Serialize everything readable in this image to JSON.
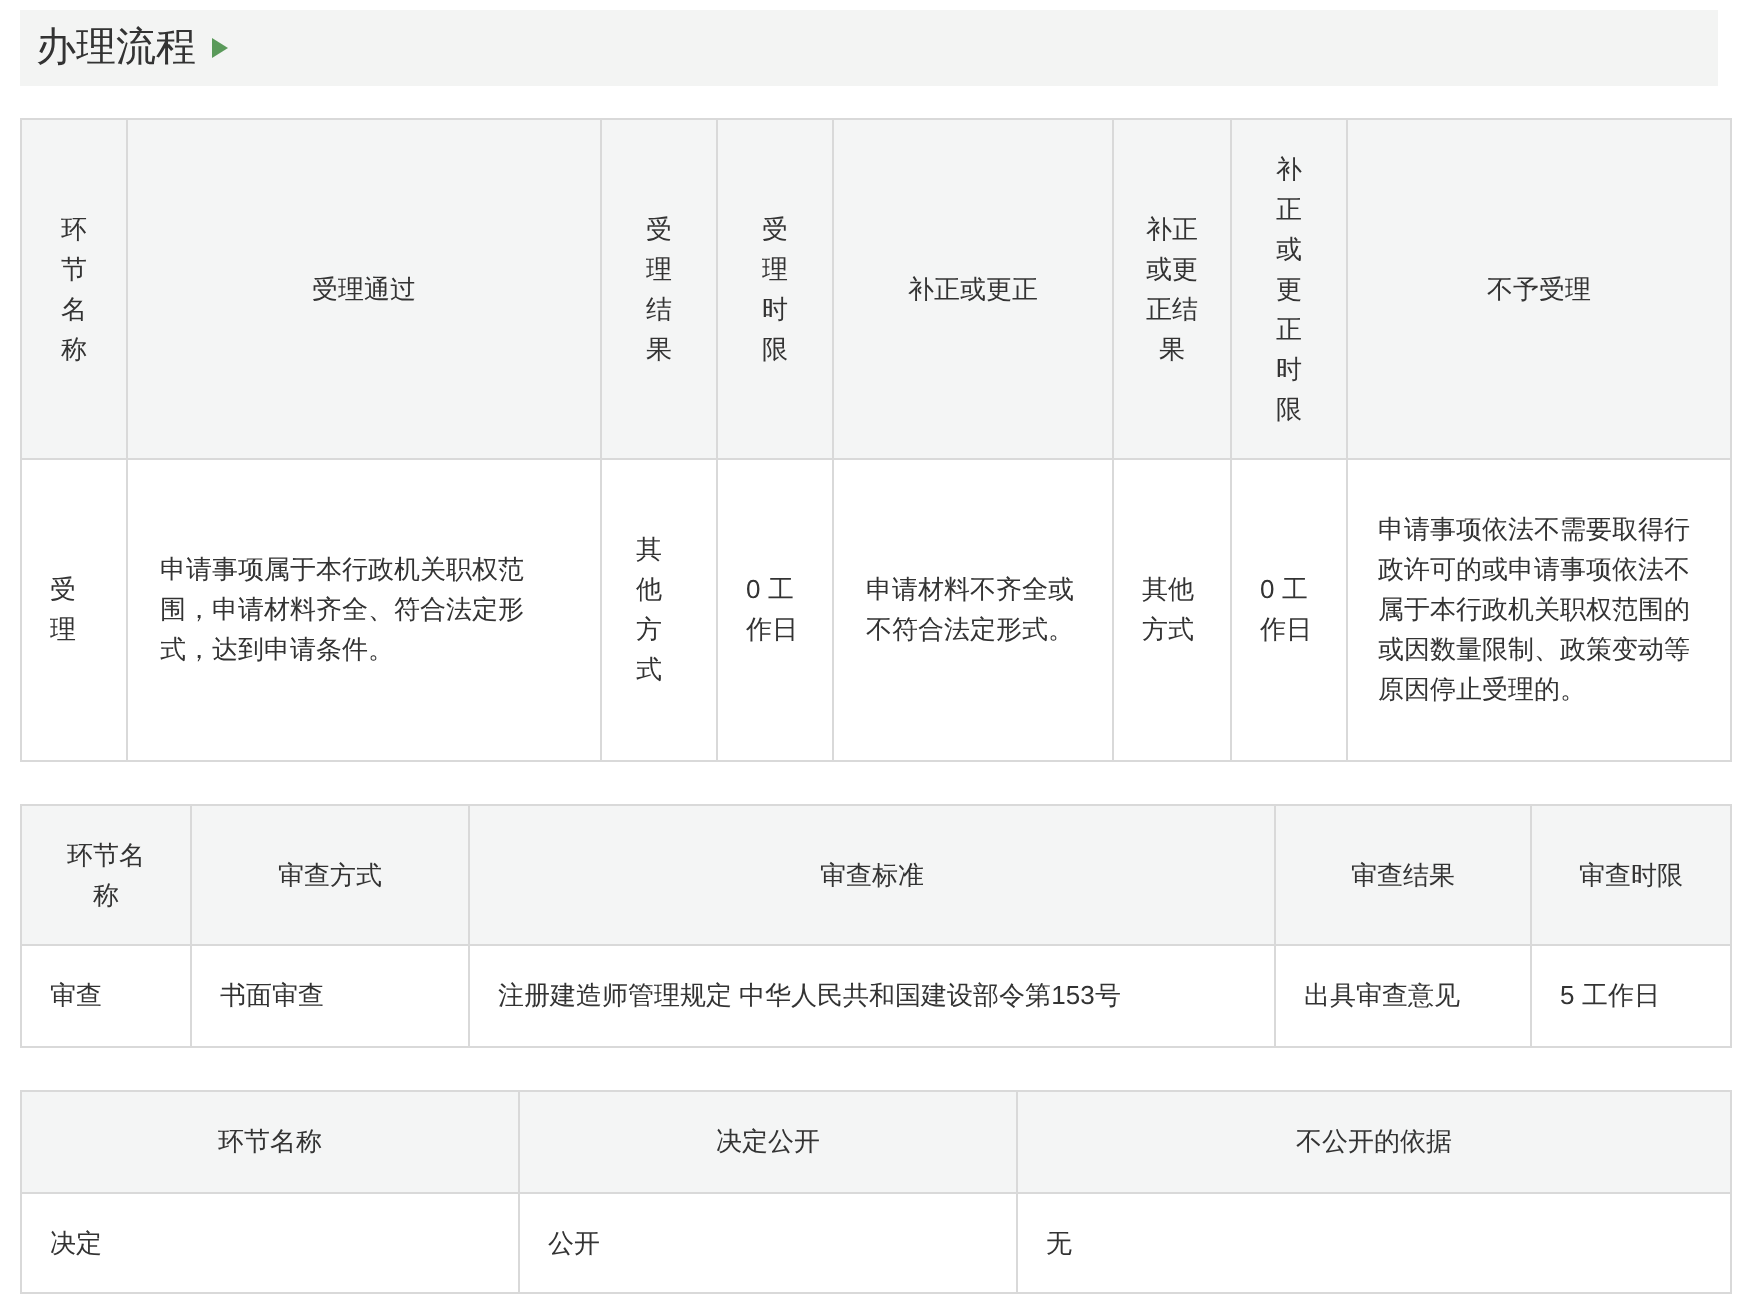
{
  "section_title": "办理流程",
  "tables": [
    {
      "columns": [
        "环节名称",
        "受理通过",
        "受理结果",
        "受理时限",
        "补正或更正",
        "补正或更正结果",
        "补正或更正时限",
        "不予受理"
      ],
      "rows": [
        [
          "受理",
          "申请事项属于本行政机关职权范围，申请材料齐全、符合法定形式，达到申请条件。",
          "其他方式",
          "0 工作日",
          "申请材料不齐全或不符合法定形式。",
          "其他方式",
          "0 工作日",
          "申请事项依法不需要取得行政许可的或申请事项依法不属于本行政机关职权范围的或因数量限制、政策变动等原因停止受理的。"
        ]
      ]
    },
    {
      "columns": [
        "环节名称",
        "审查方式",
        "审查标准",
        "审查结果",
        "审查时限"
      ],
      "rows": [
        [
          "审查",
          "书面审查",
          "注册建造师管理规定 中华人民共和国建设部令第153号",
          "出具审查意见",
          "5 工作日"
        ]
      ]
    },
    {
      "columns": [
        "环节名称",
        "决定公开",
        "不公开的依据"
      ],
      "rows": [
        [
          "决定",
          "公开",
          "无"
        ]
      ]
    }
  ]
}
